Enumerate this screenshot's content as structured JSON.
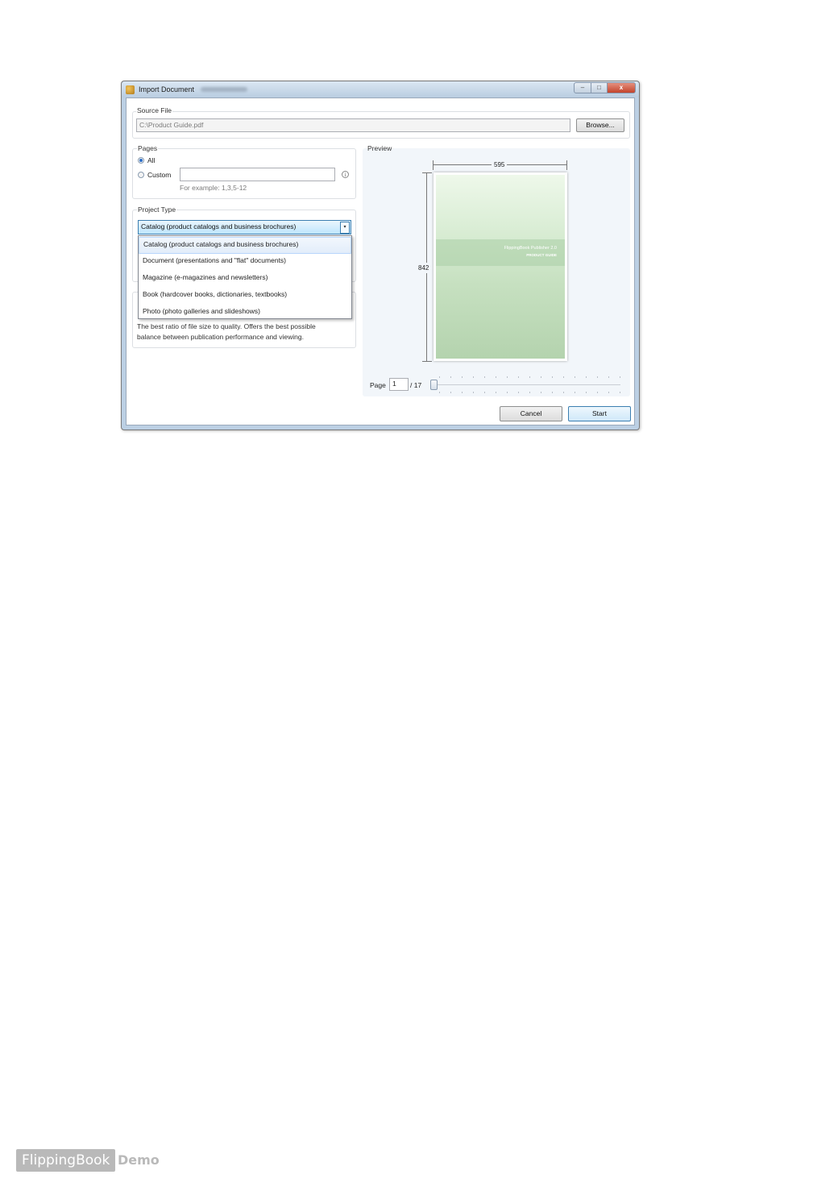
{
  "window": {
    "title": "Import Document",
    "min_glyph": "–",
    "max_glyph": "□",
    "close_glyph": "x"
  },
  "source_file": {
    "group_title": "Source File",
    "path": "C:\\Product Guide.pdf",
    "browse_label": "Browse..."
  },
  "pages": {
    "group_title": "Pages",
    "all_label": "All",
    "custom_label": "Custom",
    "custom_value": "",
    "hint": "For example: 1,3,5-12",
    "info_glyph": "i",
    "all_selected": true
  },
  "project_type": {
    "group_title": "Project Type",
    "selected": "Catalog (product catalogs and business brochures)",
    "arrow_glyph": "▾",
    "options": [
      "Catalog (product catalogs and business brochures)",
      "Document (presentations and \"flat\" documents)",
      "Magazine (e-magazines and newsletters)",
      "Book (hardcover books, dictionaries, textbooks)",
      "Photo (photo galleries and slideshows)"
    ]
  },
  "quality": {
    "description_line1": "The best ratio of file size to quality. Offers the best possible",
    "description_line2": "balance between publication performance and viewing."
  },
  "preview": {
    "group_title": "Preview",
    "width_value": "595",
    "height_value": "842",
    "brand_line": "FlippingBook Publisher 2.0",
    "product_line": "PRODUCT GUIDE",
    "page_label": "Page",
    "page_current": "1",
    "page_total": "/ 17",
    "slider_position": 0
  },
  "buttons": {
    "cancel": "Cancel",
    "start": "Start"
  },
  "footer": {
    "brand": "FlippingBook",
    "demo": "Demo"
  }
}
